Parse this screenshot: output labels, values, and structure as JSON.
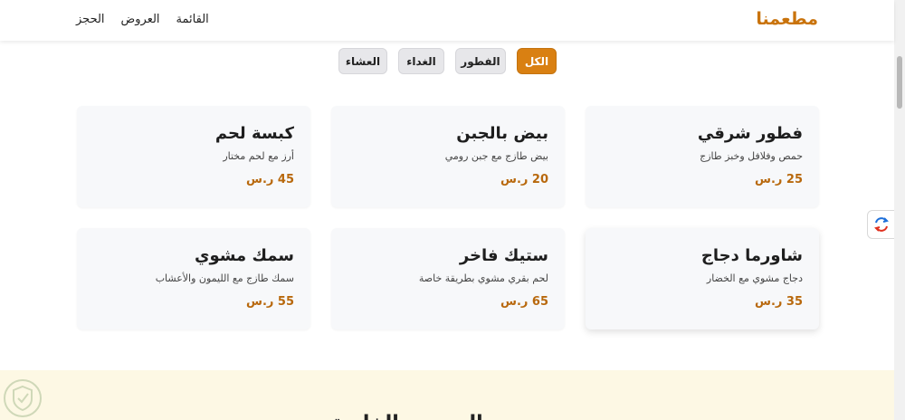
{
  "header": {
    "brand": "مطعمنا",
    "nav": [
      "القائمة",
      "العروض",
      "الحجز"
    ]
  },
  "filters": [
    {
      "label": "الكل",
      "active": true
    },
    {
      "label": "الفطور",
      "active": false
    },
    {
      "label": "الغداء",
      "active": false
    },
    {
      "label": "العشاء",
      "active": false
    }
  ],
  "menu_items": [
    {
      "name": "فطور شرقي",
      "desc": "حمص وفلافل وخبز طازج",
      "price": "25 ر.س"
    },
    {
      "name": "بيض بالجبن",
      "desc": "بيض طازج مع جبن رومي",
      "price": "20 ر.س"
    },
    {
      "name": "كبسة لحم",
      "desc": "أرز مع لحم مختار",
      "price": "45 ر.س"
    },
    {
      "name": "شاورما دجاج",
      "desc": "دجاج مشوي مع الخضار",
      "price": "35 ر.س"
    },
    {
      "name": "ستيك فاخر",
      "desc": "لحم بقري مشوي بطريقة خاصة",
      "price": "65 ر.س"
    },
    {
      "name": "سمك مشوي",
      "desc": "سمك طازج مع الليمون والأعشاب",
      "price": "55 ر.س"
    }
  ],
  "footer": {
    "partial_title": "العروض الخاصة"
  },
  "colors": {
    "accent": "#d98012",
    "price": "#b8680c",
    "footer_bg": "#fdf8e4"
  },
  "icons": {
    "floating": "translate-icon",
    "watermark": "shield-logo-icon"
  }
}
